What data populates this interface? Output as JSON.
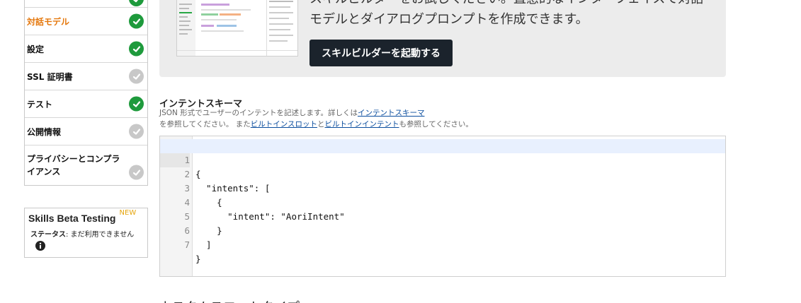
{
  "sidebar": {
    "items": [
      {
        "label": "",
        "status": "complete"
      },
      {
        "label": "対話モデル",
        "status": "complete",
        "active": true
      },
      {
        "label": "設定",
        "status": "complete"
      },
      {
        "label": "SSL 証明書",
        "status": "incomplete"
      },
      {
        "label": "テスト",
        "status": "complete"
      },
      {
        "label": "公開情報",
        "status": "incomplete"
      },
      {
        "label": "プライバシーとコンプライアンス",
        "status": "incomplete"
      }
    ],
    "status_colors": {
      "complete": "#1e9a3c",
      "incomplete": "#c8c8c8"
    }
  },
  "beta": {
    "title": "Skills Beta Testing",
    "badge": "NEW",
    "status_label": "ステータス",
    "status_value": ": まだ利用できません",
    "info_icon": "info-icon"
  },
  "builder": {
    "text": "スキルビルダーをお試しください。直感的なインターフェイスで対話モデルとダイアログプロンプトを作成できます。",
    "button_label": "スキルビルダーを起動する"
  },
  "intent_schema": {
    "title": "インテントスキーマ",
    "desc_1": "JSON 形式でユーザーのインテントを記述します。詳しくは",
    "link_schema": "インテントスキーマ",
    "desc_2": "を参照してください。 また",
    "link_slots": "ビルトインスロット",
    "desc_and": "と",
    "link_intents": "ビルトインインテント",
    "desc_3": "も参照してください。",
    "code_lines": [
      {
        "num": "1",
        "text": "{"
      },
      {
        "num": "2",
        "text": "  \"intents\": ["
      },
      {
        "num": "3",
        "text": "    {"
      },
      {
        "num": "4",
        "text": "      \"intent\": \"AoriIntent\""
      },
      {
        "num": "5",
        "text": "    }"
      },
      {
        "num": "6",
        "text": "  ]"
      },
      {
        "num": "7",
        "text": "}"
      }
    ]
  },
  "bottom_heading": "カスタムスロットタイプ"
}
